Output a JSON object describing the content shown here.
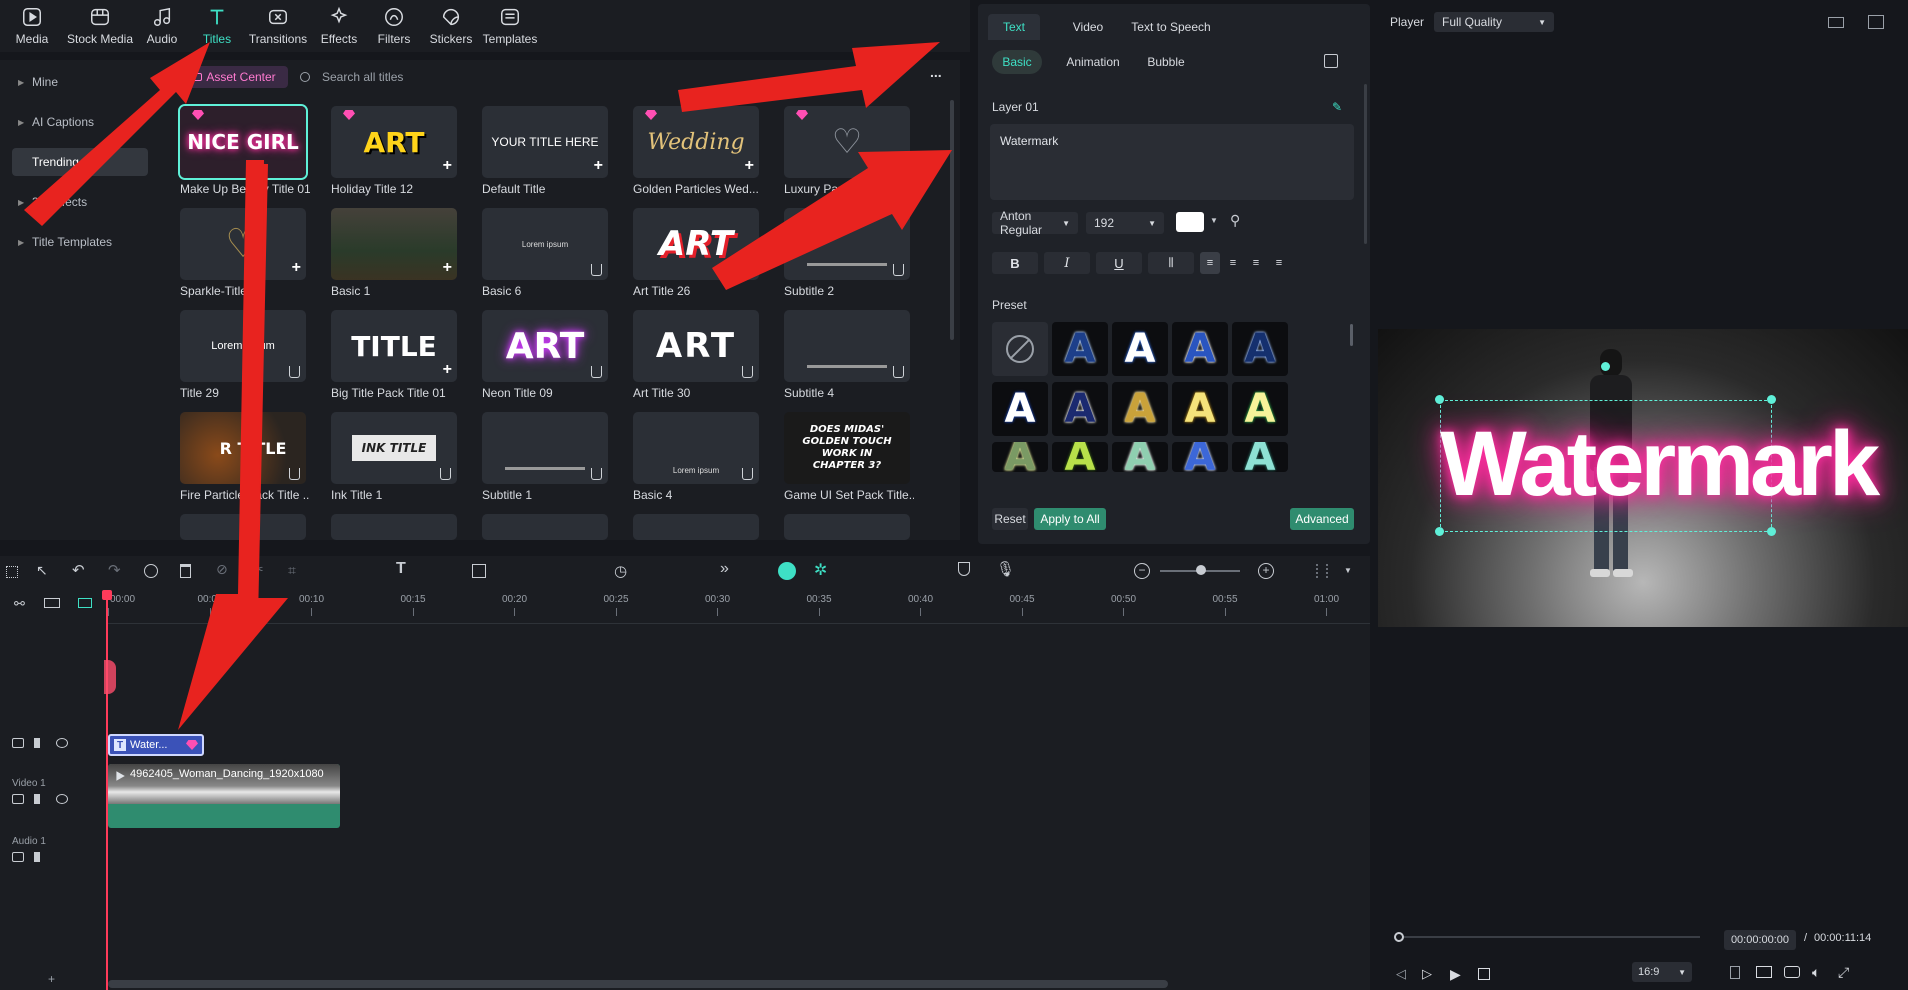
{
  "toolbar": {
    "items": [
      {
        "label": "Media",
        "icon": "media-icon"
      },
      {
        "label": "Stock Media",
        "icon": "stock-media-icon"
      },
      {
        "label": "Audio",
        "icon": "audio-icon"
      },
      {
        "label": "Titles",
        "icon": "titles-icon",
        "active": true
      },
      {
        "label": "Transitions",
        "icon": "transitions-icon"
      },
      {
        "label": "Effects",
        "icon": "effects-icon"
      },
      {
        "label": "Filters",
        "icon": "filters-icon"
      },
      {
        "label": "Stickers",
        "icon": "stickers-icon"
      },
      {
        "label": "Templates",
        "icon": "templates-icon"
      }
    ]
  },
  "sidebar": {
    "items": [
      {
        "label": "Mine"
      },
      {
        "label": "AI Captions"
      },
      {
        "label": "Trending",
        "active": true
      },
      {
        "label": "3D Effects"
      },
      {
        "label": "Title Templates"
      }
    ]
  },
  "assets": {
    "asset_center_label": "Asset Center",
    "search_placeholder": "Search all titles",
    "more": "...",
    "tiles": [
      {
        "label": "Make Up Beauty Title 01",
        "thumb": "NICE GIRL"
      },
      {
        "label": "Holiday Title 12",
        "thumb": "ART"
      },
      {
        "label": "Default Title",
        "thumb": "YOUR TITLE HERE"
      },
      {
        "label": "Golden Particles Wed...",
        "thumb": "Wedding"
      },
      {
        "label": "Luxury Particle W...",
        "thumb": ""
      },
      {
        "label": "Sparkle-Title",
        "thumb": ""
      },
      {
        "label": "Basic 1",
        "thumb": ""
      },
      {
        "label": "Basic 6",
        "thumb": "Lorem ipsum"
      },
      {
        "label": "Art Title 26",
        "thumb": "ART"
      },
      {
        "label": "Subtitle 2",
        "thumb": ""
      },
      {
        "label": "Title 29",
        "thumb": "Lorem ipsum"
      },
      {
        "label": "Big Title Pack Title 01",
        "thumb": "TITLE"
      },
      {
        "label": "Neon Title 09",
        "thumb": "ART"
      },
      {
        "label": "Art Title 30",
        "thumb": "ART"
      },
      {
        "label": "Subtitle 4",
        "thumb": ""
      },
      {
        "label": "Fire Particle Pack Title ...",
        "thumb": "R TITLE"
      },
      {
        "label": "Ink Title 1",
        "thumb": "INK TITLE"
      },
      {
        "label": "Subtitle 1",
        "thumb": ""
      },
      {
        "label": "Basic 4",
        "thumb": "Lorem ipsum"
      },
      {
        "label": "Game UI Set Pack Title...",
        "thumb": "DOES MIDAS' GOLDEN TOUCH WORK IN CHAPTER 3?"
      }
    ]
  },
  "props": {
    "tabs": [
      "Text",
      "Video",
      "Text to Speech"
    ],
    "subtabs": [
      "Basic",
      "Animation",
      "Bubble"
    ],
    "layer_label": "Layer 01",
    "text_value": "Watermark",
    "font": "Anton Regular",
    "size": "192",
    "text_color": "#ffffff",
    "format": [
      "B",
      "I",
      "U"
    ],
    "preset_label": "Preset",
    "presets": [
      {
        "fill": "#1d3f8a",
        "stroke": "#b7d4ff"
      },
      {
        "fill": "#ffffff",
        "stroke": "#3366cc"
      },
      {
        "fill": "#2a55c0",
        "stroke": "#ffffff"
      },
      {
        "fill": "#15306e",
        "stroke": "#9fc0ff"
      },
      {
        "fill": "#ffffff",
        "stroke": "#1a3fa0"
      },
      {
        "fill": "#1b2a70",
        "stroke": "#f0f0f0"
      },
      {
        "fill": "#c9a23a",
        "stroke": "#ffe8a0"
      },
      {
        "fill": "#f5e27a",
        "stroke": "#9c7a1c"
      },
      {
        "fill": "#f6f39a",
        "stroke": "#2e9c45"
      },
      {
        "fill": "#7a9a64",
        "stroke": "#e4ef9d"
      },
      {
        "fill": "#b8e04a",
        "stroke": "#375d16"
      },
      {
        "fill": "#8fcfb0",
        "stroke": "#eefff5"
      },
      {
        "fill": "#3c67d8",
        "stroke": "#c9d8ff"
      },
      {
        "fill": "#8ee1d4",
        "stroke": "#2b6d62"
      }
    ],
    "reset_label": "Reset",
    "apply_label": "Apply to All",
    "advanced_label": "Advanced"
  },
  "player": {
    "label": "Player",
    "quality": "Full Quality",
    "overlay_text": "Watermark",
    "current_time": "00:00:00:00",
    "separator": "/",
    "total_time": "00:00:11:14",
    "aspect": "16:9",
    "playback_progress": 0.0
  },
  "timeline": {
    "ruler": [
      "00:00",
      "00:00:05",
      "00:00:10",
      "00:00:15",
      "00:00:20",
      "00:00:25",
      "00:00:30",
      "00:00:35",
      "00:00:40",
      "00:00:45",
      "00:00:50",
      "00:00:55",
      "00:01:00"
    ],
    "ruler_short": [
      "00:00",
      "00:05",
      "00:10",
      "00:15",
      "00:20",
      "00:25",
      "00:30",
      "00:35",
      "00:40",
      "00:45",
      "00:50",
      "00:55",
      "01:00"
    ],
    "title_clip": "Water...",
    "video_track_label": "Video 1",
    "video_clip": "4962405_Woman_Dancing_1920x1080",
    "audio_track_label": "Audio 1",
    "add_track": "+"
  },
  "colors": {
    "accent": "#3ee0c5",
    "pink": "#ff4fb3",
    "arrow": "#e8231f",
    "clip_green": "#2f8c6f",
    "title_clip": "#3b52b8"
  }
}
